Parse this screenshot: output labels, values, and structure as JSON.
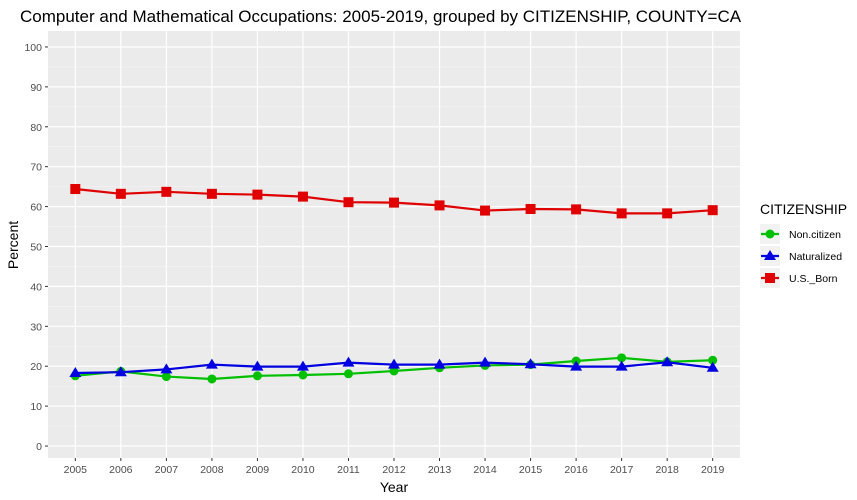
{
  "chart_data": {
    "type": "line",
    "title": "Computer and Mathematical Occupations: 2005-2019, grouped by CITIZENSHIP, COUNTY=CA",
    "xlabel": "Year",
    "ylabel": "Percent",
    "x": [
      "2005",
      "2006",
      "2007",
      "2008",
      "2009",
      "2010",
      "2011",
      "2012",
      "2013",
      "2014",
      "2015",
      "2016",
      "2017",
      "2018",
      "2019"
    ],
    "ylim": [
      -3,
      104
    ],
    "yticks": [
      0,
      10,
      20,
      30,
      40,
      50,
      60,
      70,
      80,
      90,
      100
    ],
    "grid": true,
    "legend": {
      "title": "CITIZENSHIP",
      "position": "right"
    },
    "series": [
      {
        "name": "Non.citizen",
        "color": "#00c000",
        "marker": "circle",
        "values": [
          17.6,
          18.7,
          17.4,
          16.8,
          17.6,
          17.8,
          18.1,
          18.8,
          19.6,
          20.2,
          20.4,
          21.3,
          22.1,
          21.1,
          21.5
        ]
      },
      {
        "name": "Naturalized",
        "color": "#0000e0",
        "marker": "triangle",
        "values": [
          18.3,
          18.5,
          19.2,
          20.4,
          19.9,
          19.9,
          20.9,
          20.4,
          20.4,
          20.9,
          20.5,
          19.9,
          19.9,
          21.0,
          19.6
        ]
      },
      {
        "name": "U.S._Born",
        "color": "#e00000",
        "marker": "square",
        "values": [
          64.4,
          63.2,
          63.7,
          63.2,
          63.0,
          62.5,
          61.1,
          61.0,
          60.3,
          59.0,
          59.4,
          59.3,
          58.3,
          58.3,
          59.1
        ]
      }
    ]
  }
}
